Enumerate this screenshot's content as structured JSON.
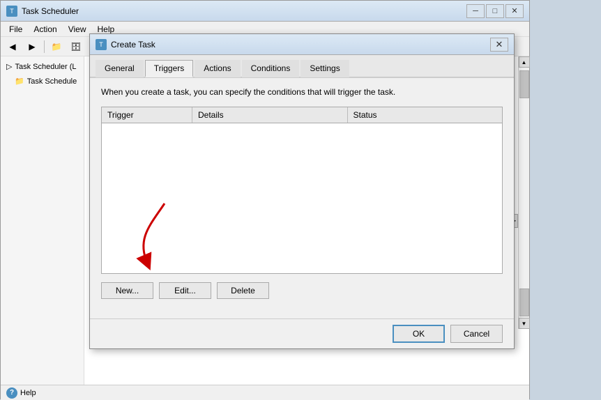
{
  "app": {
    "title": "Task Scheduler",
    "icon": "T"
  },
  "menu": {
    "items": [
      "File",
      "Action",
      "View",
      "Help"
    ]
  },
  "toolbar": {
    "buttons": [
      "◀",
      "▶",
      "📁",
      "🗄"
    ]
  },
  "sidebar": {
    "items": [
      {
        "label": "Task Scheduler (L",
        "indent": 0
      },
      {
        "label": "Task Schedule",
        "indent": 1
      }
    ]
  },
  "statusbar": {
    "help_label": "Help",
    "help_icon": "?"
  },
  "dialog": {
    "title": "Create Task",
    "icon": "T",
    "tabs": [
      {
        "label": "General",
        "active": false
      },
      {
        "label": "Triggers",
        "active": true
      },
      {
        "label": "Actions",
        "active": false
      },
      {
        "label": "Conditions",
        "active": false
      },
      {
        "label": "Settings",
        "active": false
      }
    ],
    "description": "When you create a task, you can specify the conditions that will trigger the task.",
    "table": {
      "columns": [
        {
          "label": "Trigger",
          "key": "trigger"
        },
        {
          "label": "Details",
          "key": "details"
        },
        {
          "label": "Status",
          "key": "status"
        }
      ],
      "rows": []
    },
    "buttons": {
      "new": "New...",
      "edit": "Edit...",
      "delete": "Delete"
    },
    "footer": {
      "ok": "OK",
      "cancel": "Cancel"
    }
  },
  "scrollbar": {
    "up_arrow": "▲",
    "down_arrow": "▼",
    "right_arrow": "▶"
  }
}
